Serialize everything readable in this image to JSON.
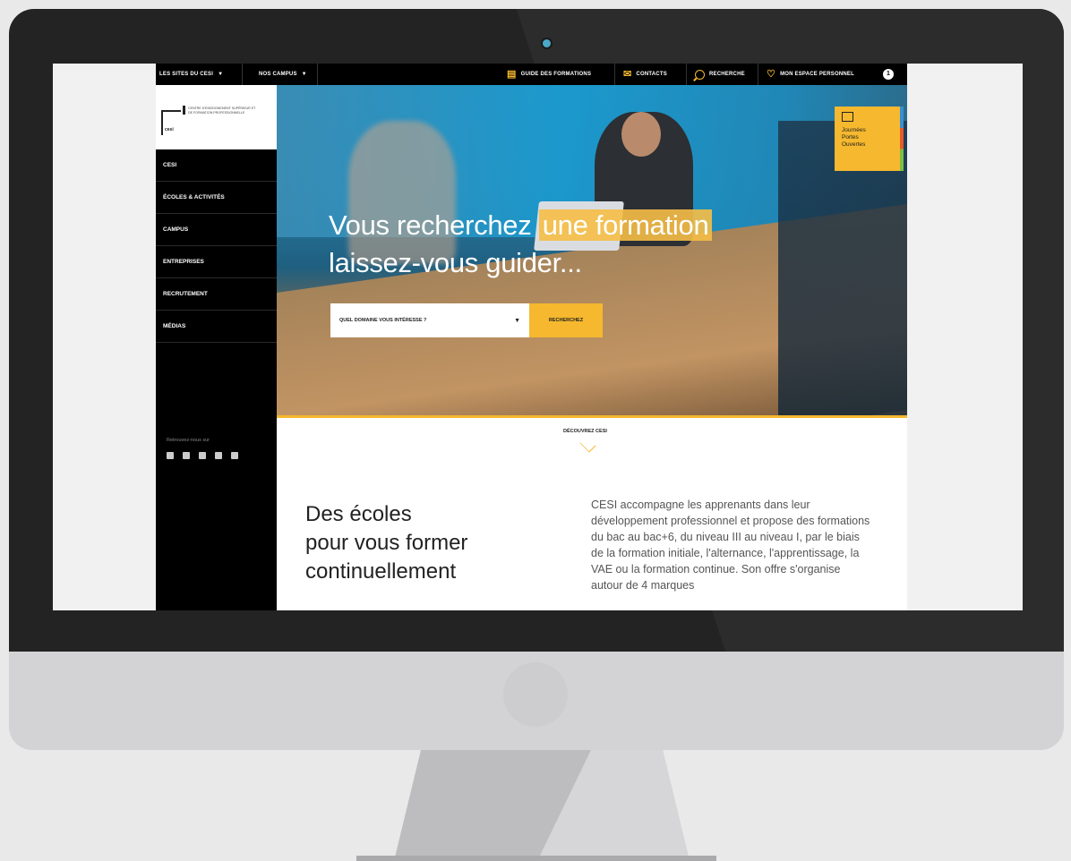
{
  "topbar": {
    "sites_label": "LES SITES DU CESI",
    "campus_label": "NOS CAMPUS",
    "guide_label": "GUIDE DES FORMATIONS",
    "contacts_label": "CONTACTS",
    "search_label": "RECHERCHE",
    "space_label": "MON ESPACE PERSONNEL",
    "user_badge": "1"
  },
  "logo": {
    "mark": "cesi",
    "tagline": "CENTRE D'ENSEIGNEMENT SUPÉRIEUR ET DE FORMATION PROFESSIONNELLE"
  },
  "sidebar": {
    "items": [
      {
        "label": "CESI"
      },
      {
        "label": "ÉCOLES & ACTIVITÉS"
      },
      {
        "label": "CAMPUS"
      },
      {
        "label": "ENTREPRISES"
      },
      {
        "label": "RECRUTEMENT"
      },
      {
        "label": "MÉDIAS"
      }
    ],
    "follow_label": "Retrouvez-nous sur",
    "socials": [
      "facebook-icon",
      "twitter-icon",
      "linkedin-icon",
      "instagram-icon",
      "youtube-icon"
    ]
  },
  "hero": {
    "title_part1": "Vous recherchez ",
    "title_highlight": "une formation",
    "title_line2": "laissez-vous guider...",
    "select_placeholder": "QUEL DOMAINE VOUS INTÉRESSE ?",
    "search_button": "RECHERCHEZ",
    "jpo_line1": "Journées",
    "jpo_line2": "Portes",
    "jpo_line3": "Ouvertes"
  },
  "discover_label": "DÉCOUVREZ CESI",
  "intro": {
    "title": "Des écoles\npour vous former\ncontinuellement",
    "text": "CESI accompagne les apprenants dans leur développement professionnel et propose des formations du bac au bac+6, du niveau III au niveau I, par le biais de la formation initiale, l'alternance, l'apprentissage, la VAE ou la formation continue.  Son offre s'organise autour de 4 marques"
  },
  "colors": {
    "accent": "#f5b82e",
    "sidebar": "#000000",
    "bezel": "#232323"
  }
}
